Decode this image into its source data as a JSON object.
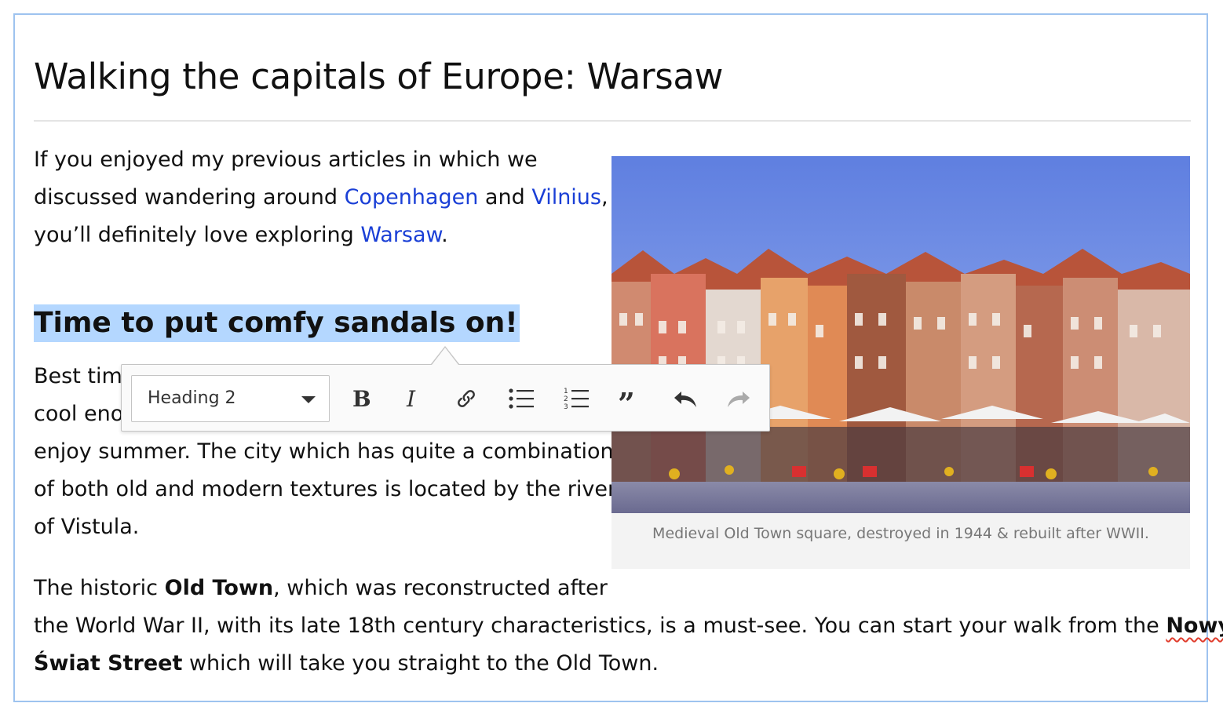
{
  "article": {
    "title": "Walking the capitals of Europe: Warsaw",
    "intro": {
      "line1": "If you enjoyed my previous articles in which we",
      "line2_a": "discussed wandering around ",
      "link_copenhagen": "Copenhagen",
      "line2_b": " and ",
      "link_vilnius": "Vilnius",
      "line2_c": ",",
      "line3_a": "you’ll definitely love exploring ",
      "link_warsaw": "Warsaw",
      "line3_b": "."
    },
    "heading": "Time to put comfy sandals on!",
    "para2": {
      "line1": "Best time",
      "line2": "cool enou",
      "line3": "enjoy summer. The city which has quite a combination",
      "line4": "of both old and modern textures is located by the river",
      "line5": "of Vistula."
    },
    "para3": {
      "line1_a": "The historic ",
      "line1_bold": "Old Town",
      "line1_b": ", which was reconstructed after",
      "line2_a": "the World War II, with its late 18th century characteristics, is a must-see. You can start your walk from the ",
      "line2_bold": "Nowy",
      "line3_bold": "Świat Street",
      "line3_b": " which will take you straight to the Old Town."
    },
    "figure": {
      "caption": "Medieval Old Town square, destroyed in 1944 & rebuilt after WWII."
    }
  },
  "toolbar": {
    "heading_dropdown_value": "Heading 2",
    "buttons": [
      {
        "name": "bold-icon"
      },
      {
        "name": "italic-icon"
      },
      {
        "name": "link-icon"
      },
      {
        "name": "bulleted-list-icon"
      },
      {
        "name": "numbered-list-icon"
      },
      {
        "name": "block-quote-icon"
      },
      {
        "name": "undo-icon"
      },
      {
        "name": "redo-icon"
      }
    ]
  },
  "colors": {
    "link": "#1a3fd6",
    "selection": "#b4d7ff",
    "editor_border": "#9ec3ef",
    "caption_text": "#777777"
  }
}
